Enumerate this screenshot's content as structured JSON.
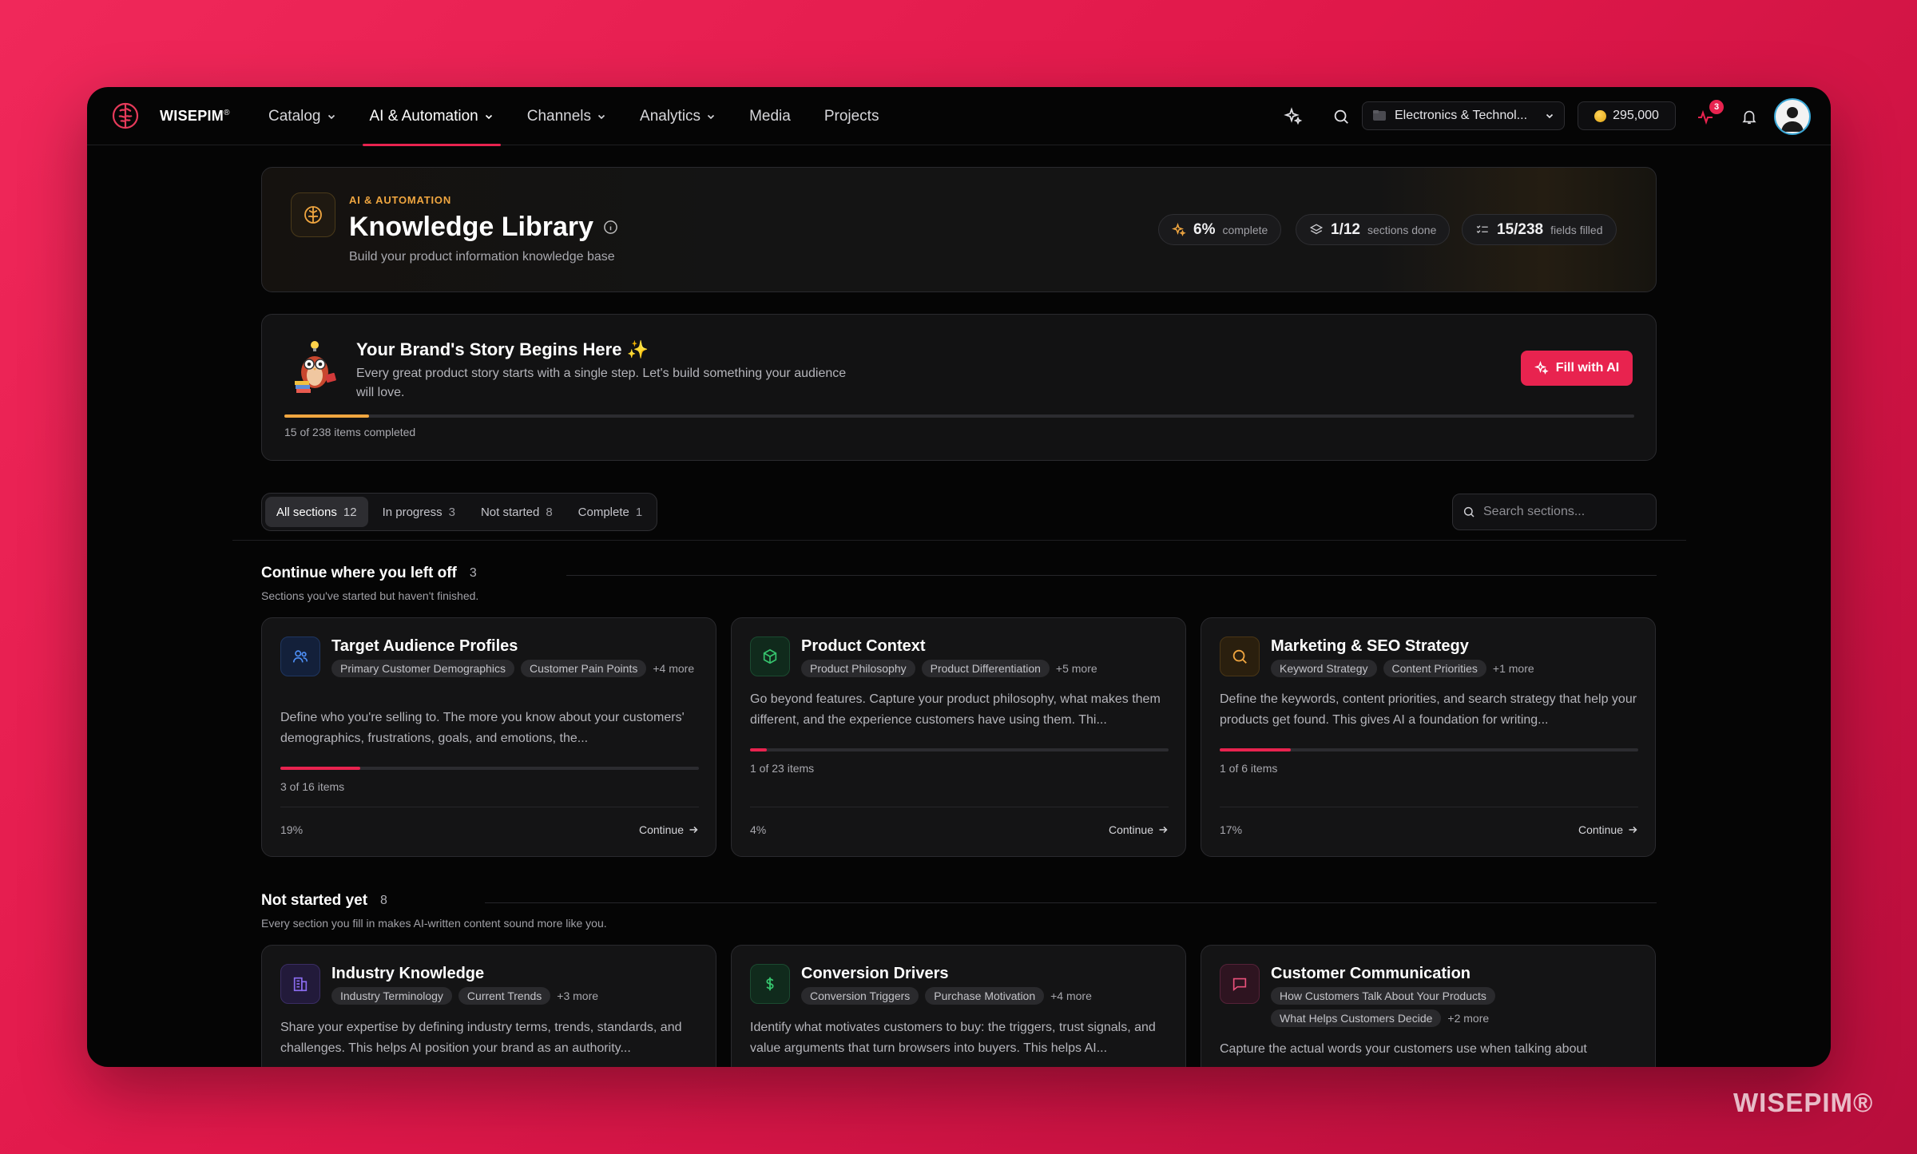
{
  "app": {
    "brand": "WISEPIM",
    "brand_mark": "®",
    "watermark": "WISEPIM®"
  },
  "nav": {
    "items": [
      {
        "label": "Catalog",
        "has_dropdown": true,
        "active": false
      },
      {
        "label": "AI & Automation",
        "has_dropdown": true,
        "active": true
      },
      {
        "label": "Channels",
        "has_dropdown": true,
        "active": false
      },
      {
        "label": "Analytics",
        "has_dropdown": true,
        "active": false
      },
      {
        "label": "Media",
        "has_dropdown": false,
        "active": false
      },
      {
        "label": "Projects",
        "has_dropdown": false,
        "active": false
      }
    ],
    "workspace": "Electronics & Technol...",
    "credits": "295,000",
    "activity_badge": "3",
    "icons": [
      "sparkle-icon",
      "search-icon",
      "activity-icon",
      "bell-icon",
      "avatar"
    ]
  },
  "hero": {
    "eyebrow": "AI & AUTOMATION",
    "title": "Knowledge Library",
    "subtitle": "Build your product information knowledge base",
    "stats": [
      {
        "value": "6%",
        "label": "complete",
        "icon": "sparkle-icon"
      },
      {
        "value": "1/12",
        "label": "sections done",
        "icon": "layers-icon"
      },
      {
        "value": "15/238",
        "label": "fields filled",
        "icon": "checklist-icon"
      }
    ]
  },
  "story": {
    "title": "Your Brand's Story Begins Here ✨",
    "text": "Every great product story starts with a single step. Let's build something your audience will love.",
    "button": "Fill with AI",
    "progress": 0.063,
    "count_text": "15 of 238 items completed"
  },
  "filters": {
    "tabs": [
      {
        "label": "All sections",
        "count": "12",
        "active": true
      },
      {
        "label": "In progress",
        "count": "3",
        "active": false
      },
      {
        "label": "Not started",
        "count": "8",
        "active": false
      },
      {
        "label": "Complete",
        "count": "1",
        "active": false
      }
    ],
    "search_placeholder": "Search sections..."
  },
  "continue_section": {
    "title": "Continue where you left off",
    "count": "3",
    "subtitle": "Sections you've started but haven't finished.",
    "cards": [
      {
        "title": "Target Audience Profiles",
        "icon": "users-icon",
        "tags": [
          "Primary Customer Demographics",
          "Customer Pain Points"
        ],
        "more": "+4 more",
        "desc": "Define who you're selling to. The more you know about your customers' demographics, frustrations, goals, and emotions, the...",
        "progress": 0.19,
        "items": "3 of 16 items",
        "pct": "19%",
        "action": "Continue"
      },
      {
        "title": "Product Context",
        "icon": "cube-icon",
        "tags": [
          "Product Philosophy",
          "Product Differentiation"
        ],
        "more": "+5 more",
        "desc": "Go beyond features. Capture your product philosophy, what makes them different, and the experience customers have using them. Thi...",
        "progress": 0.04,
        "items": "1 of 23 items",
        "pct": "4%",
        "action": "Continue"
      },
      {
        "title": "Marketing & SEO Strategy",
        "icon": "search-icon",
        "tags": [
          "Keyword Strategy",
          "Content Priorities"
        ],
        "more": "+1 more",
        "desc": "Define the keywords, content priorities, and search strategy that help your products get found. This gives AI a foundation for writing...",
        "progress": 0.17,
        "items": "1 of 6 items",
        "pct": "17%",
        "action": "Continue"
      }
    ]
  },
  "not_started_section": {
    "title": "Not started yet",
    "count": "8",
    "subtitle": "Every section you fill in makes AI-written content sound more like you.",
    "cards": [
      {
        "title": "Industry Knowledge",
        "icon": "building-icon",
        "tags": [
          "Industry Terminology",
          "Current Trends"
        ],
        "more": "+3 more",
        "desc": "Share your expertise by defining industry terms, trends, standards, and challenges. This helps AI position your brand as an authority..."
      },
      {
        "title": "Conversion Drivers",
        "icon": "dollar-icon",
        "tags": [
          "Conversion Triggers",
          "Purchase Motivation"
        ],
        "more": "+4 more",
        "desc": "Identify what motivates customers to buy: the triggers, trust signals, and value arguments that turn browsers into buyers. This helps AI..."
      },
      {
        "title": "Customer Communication",
        "icon": "chat-icon",
        "tags": [
          "How Customers Talk About Your Products",
          "What Helps Customers Decide"
        ],
        "more": "+2 more",
        "desc": "Capture the actual words your customers use when talking about"
      }
    ]
  },
  "colors": {
    "accent": "#e8234f",
    "amber": "#f0a640",
    "bg": "#050505",
    "card": "#141415"
  }
}
